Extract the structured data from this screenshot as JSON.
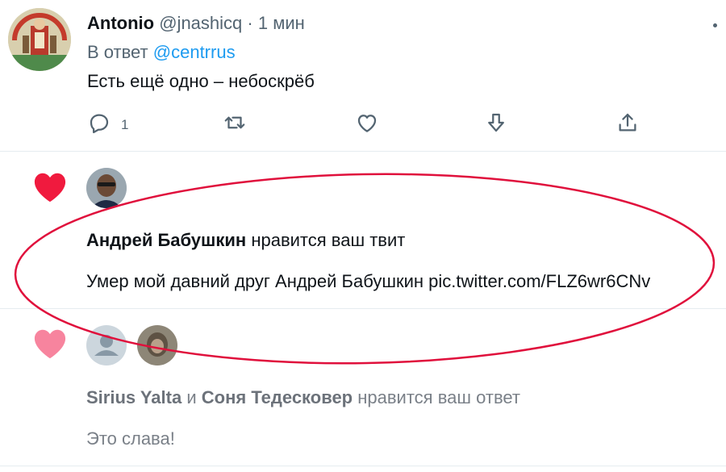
{
  "tweet": {
    "author_name": "Antonio",
    "author_handle": "@jnashicq",
    "separator": "·",
    "time": "1 мин",
    "reply_prefix": "В ответ",
    "reply_to": "@centrrus",
    "text": "Есть ещё одно – небоскрёб",
    "reply_count": "1",
    "icons": [
      "reply-icon",
      "retweet-icon",
      "like-icon",
      "bookmark-icon",
      "share-icon"
    ]
  },
  "notifications": [
    {
      "icon": "heart-icon",
      "actor": "Андрей Бабушкин",
      "action": "нравится ваш твит",
      "text": "Умер мой давний друг Андрей Бабушкин pic.twitter.com/FLZ6wr6CNv"
    },
    {
      "icon": "heart-icon",
      "actor1": "Sirius Yalta",
      "conjunction": "и",
      "actor2": "Соня Тедесковер",
      "action": "нравится ваш ответ",
      "text": "Это слава!"
    }
  ],
  "colors": {
    "heart_active": "#f91880",
    "heart_faded": "#f7849e",
    "link": "#1d9bf0",
    "highlight_ellipse": "#e0103c"
  }
}
